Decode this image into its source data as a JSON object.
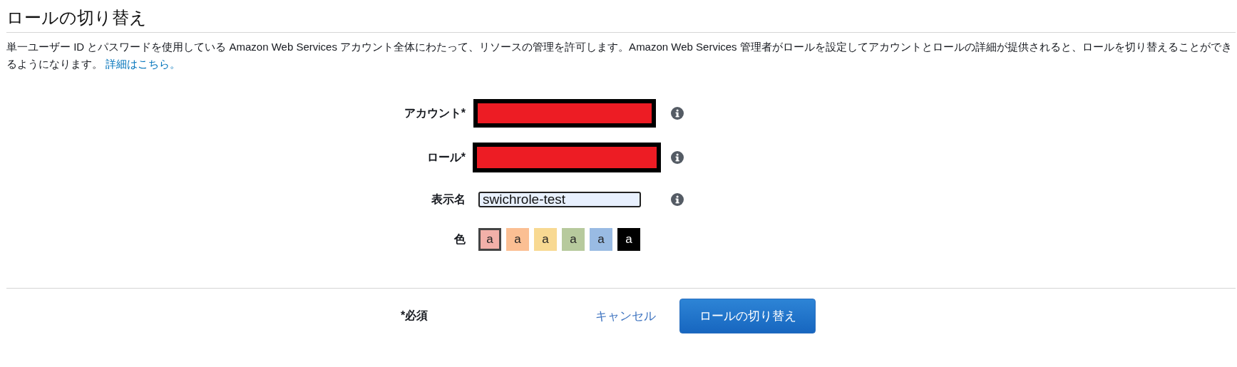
{
  "title": "ロールの切り替え",
  "description": "単一ユーザー ID とパスワードを使用している Amazon Web Services アカウント全体にわたって、リソースの管理を許可します。Amazon Web Services 管理者がロールを設定してアカウントとロールの詳細が提供されると、ロールを切り替えることができるようになります。",
  "help_link": "詳細はこちら。",
  "fields": [
    {
      "label": "アカウント*",
      "kind": "redacted"
    },
    {
      "label": "ロール*",
      "kind": "redacted"
    },
    {
      "label": "表示名",
      "kind": "text",
      "value": "swichrole-test",
      "focused": true
    }
  ],
  "color": {
    "label": "色",
    "swatches": [
      {
        "text": "a",
        "color": "#f2b0a9",
        "selected": true
      },
      {
        "text": "a",
        "color": "#fbbf93",
        "selected": false
      },
      {
        "text": "a",
        "color": "#f8d992",
        "selected": false
      },
      {
        "text": "a",
        "color": "#b7ca9d",
        "selected": false
      },
      {
        "text": "a",
        "color": "#99bbe3",
        "selected": false
      },
      {
        "text": "a",
        "color": "#000000",
        "selected": false
      }
    ]
  },
  "footer": {
    "required_note": "*必須",
    "cancel": "キャンセル",
    "submit": "ロールの切り替え"
  }
}
